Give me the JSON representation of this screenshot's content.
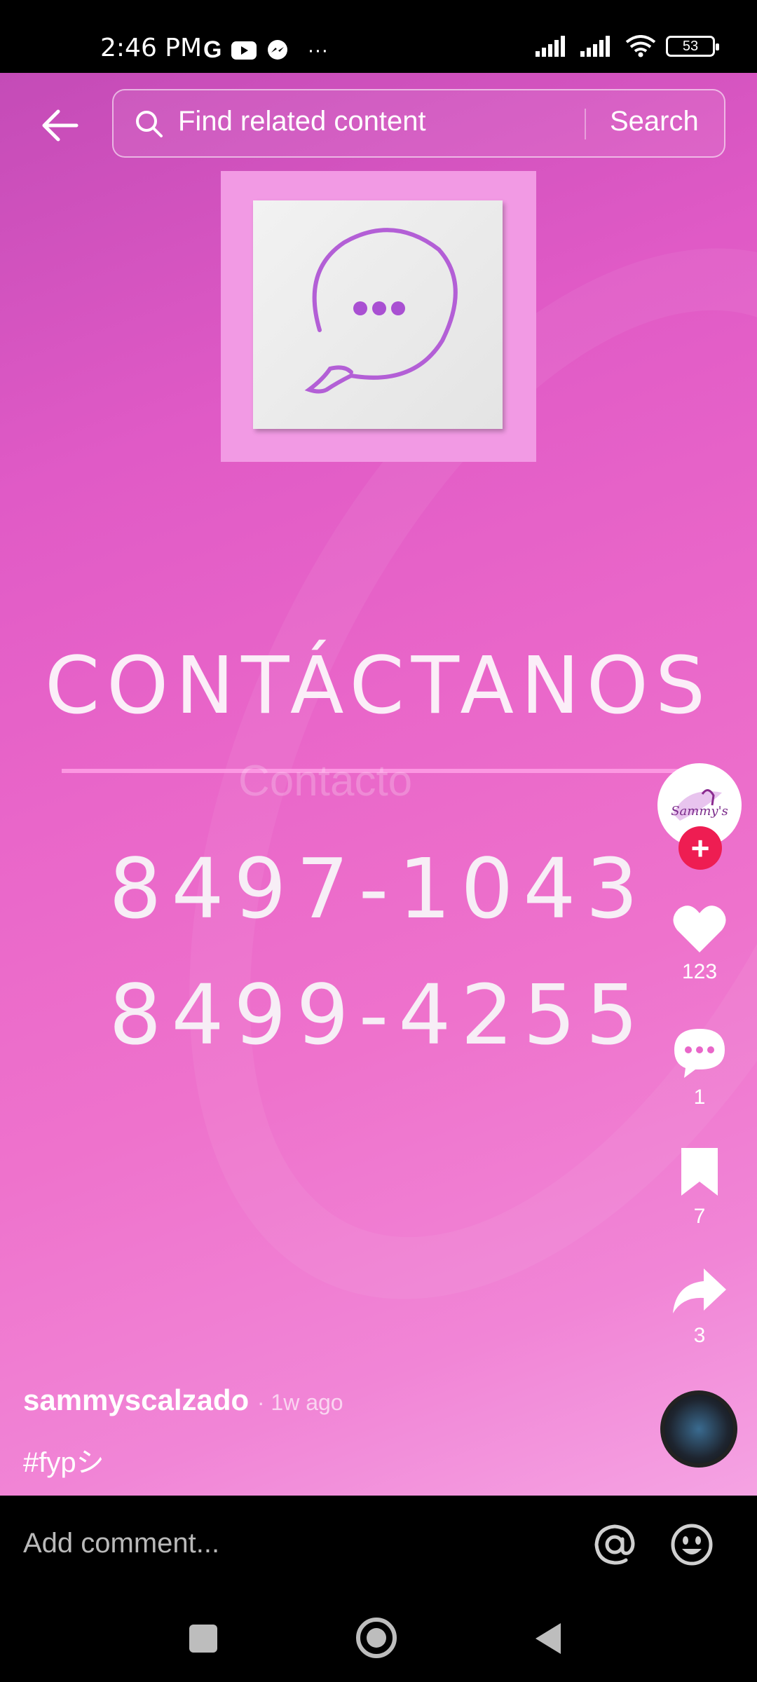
{
  "status_bar": {
    "time": "2:46 PM",
    "battery": "53"
  },
  "search": {
    "placeholder": "Find related content",
    "button_label": "Search"
  },
  "video": {
    "heading": "CONTÁCTANOS",
    "subheading_faint": "Contacto",
    "phone_1": "8497-1043",
    "phone_2": "8499-4255"
  },
  "rail": {
    "avatar_label": "Sammy's",
    "likes": "123",
    "comments": "1",
    "saves": "7",
    "shares": "3"
  },
  "post": {
    "author": "sammyscalzado",
    "time_ago": "· 1w ago",
    "caption": "#fypシ"
  },
  "comment_bar": {
    "placeholder": "Add comment..."
  },
  "colors": {
    "accent_red": "#ee1d52",
    "bg_pink": "#e966c9"
  }
}
